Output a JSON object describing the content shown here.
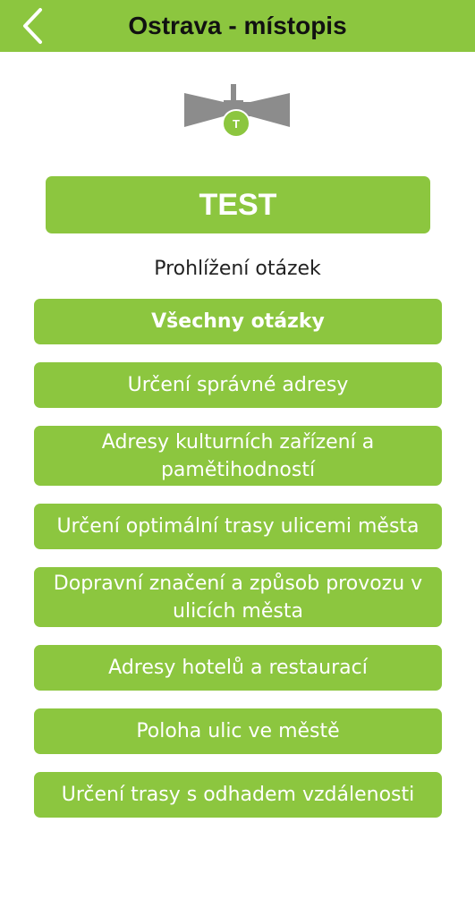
{
  "header": {
    "title": "Ostrava - místopis",
    "back_icon": "chevron-left-icon",
    "background": "#8cc63f"
  },
  "logo": {
    "icon": "tram-pantograph-logo",
    "badge_letter": "T"
  },
  "test_button": {
    "label": "TEST"
  },
  "browse": {
    "label": "Prohlížení otázek",
    "items": [
      {
        "label": "Všechny otázky"
      },
      {
        "label": "Určení správné adresy"
      },
      {
        "label": "Adresy kulturních zařízení a pamětihodností"
      },
      {
        "label": "Určení optimální trasy ulicemi města"
      },
      {
        "label": "Dopravní značení a způsob provozu v ulicích města"
      },
      {
        "label": "Adresy hotelů a restaurací"
      },
      {
        "label": "Poloha ulic ve městě"
      },
      {
        "label": "Určení trasy s odhadem vzdálenosti"
      }
    ]
  },
  "colors": {
    "accent": "#8cc63f",
    "logo_gray": "#8c8c8c",
    "button_text": "#ffffff"
  }
}
